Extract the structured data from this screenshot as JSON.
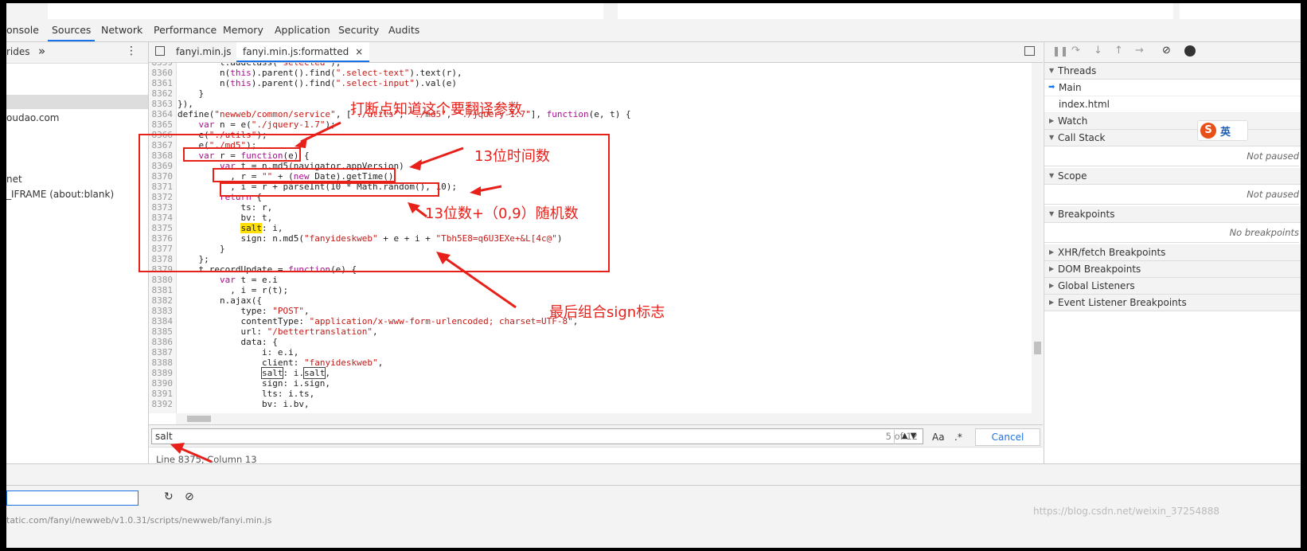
{
  "devtools": {
    "tabs": [
      "onsole",
      "Sources",
      "Network",
      "Performance",
      "Memory",
      "Application",
      "Security",
      "Audits"
    ],
    "active_tab": "Sources"
  },
  "left_panel": {
    "header_label": "rides",
    "header_more": "»",
    "items": [
      "oudao.com",
      "net",
      "_IFRAME (about:blank)"
    ]
  },
  "editor": {
    "file_tabs": [
      "fanyi.min.js",
      "fanyi.min.js:formatted"
    ],
    "close_glyph": "×",
    "status": "Line 8375, Column 13"
  },
  "search": {
    "query": "salt",
    "count": "5 of 12",
    "case_label": "Aa",
    "regex_label": ".*",
    "cancel_label": "Cancel"
  },
  "right_panel": {
    "threads_label": "Threads",
    "thread_main": "Main",
    "thread_index": "index.html",
    "watch_label": "Watch",
    "call_stack_label": "Call Stack",
    "call_stack_note": "Not paused",
    "scope_label": "Scope",
    "scope_note": "Not paused",
    "breakpoints_label": "Breakpoints",
    "breakpoints_note": "No breakpoints",
    "xhr_label": "XHR/fetch Breakpoints",
    "dom_label": "DOM Breakpoints",
    "global_label": "Global Listeners",
    "event_label": "Event Listener Breakpoints",
    "ime_badge": "英"
  },
  "bottom": {
    "url": "tatic.com/fanyi/newweb/v1.0.31/scripts/newweb/fanyi.min.js",
    "watermark": "https://blog.csdn.net/weixin_37254888"
  },
  "annotations": {
    "a1": "打断点知道这个要翻译参数",
    "a2": "13位时间数",
    "a3": "13位数+（0,9）随机数",
    "a4": "最后组合sign标志"
  },
  "colors": {
    "annotation": "#e8201a",
    "accent": "#1a73e8",
    "highlight": "#ffe000"
  }
}
